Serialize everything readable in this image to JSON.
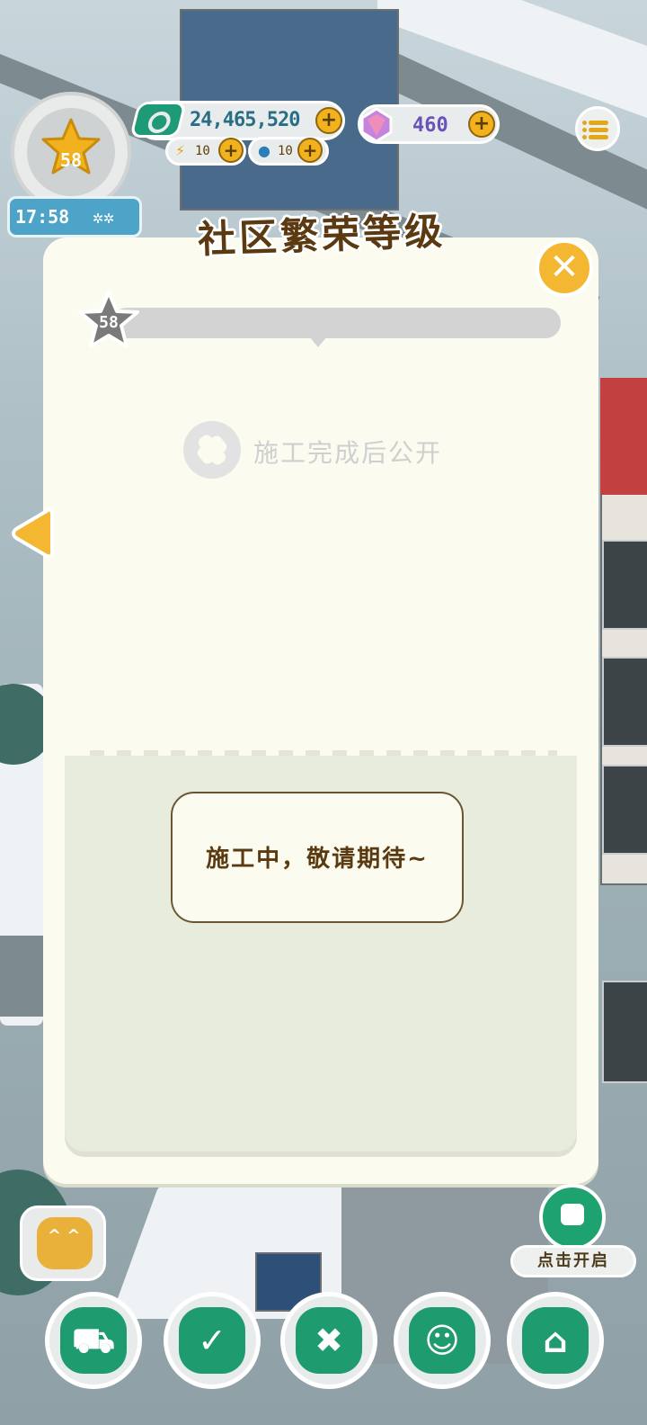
{
  "hud": {
    "level": "58",
    "clock": "17:58",
    "weather_icon": "snowflake-icon",
    "money": "24,465,520",
    "energy": "10",
    "water": "10",
    "gems": "460",
    "plus_glyph": "+"
  },
  "modal": {
    "title": "社区繁荣等级",
    "close_glyph": "✕",
    "current_level": "58",
    "progress": 0,
    "locked_text": "施工完成后公开",
    "message": "施工中，敬请期待~"
  },
  "bottom": {
    "tv_label": "点击开启",
    "dock": [
      {
        "name": "shop",
        "icon": "cart-icon"
      },
      {
        "name": "tasks",
        "icon": "clipboard-check-icon"
      },
      {
        "name": "build",
        "icon": "tools-icon"
      },
      {
        "name": "residents",
        "icon": "face-icon"
      },
      {
        "name": "home",
        "icon": "house-icon"
      }
    ]
  },
  "colors": {
    "accent_yellow": "#f1b426",
    "accent_green": "#1f9b70",
    "title_brown": "#5b3a11",
    "modal_bg": "#fbfcef"
  }
}
